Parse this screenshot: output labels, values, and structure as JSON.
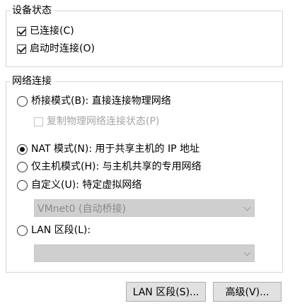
{
  "device_status": {
    "title": "设备状态",
    "connected": {
      "label": "已连接(C)",
      "checked": true
    },
    "connect_at_power_on": {
      "label": "启动时连接(O)",
      "checked": true
    }
  },
  "network_connection": {
    "title": "网络连接",
    "bridged": {
      "label": "桥接模式(B): 直接连接物理网络",
      "selected": false
    },
    "replicate_state": {
      "label": "复制物理网络连接状态(P)",
      "checked": false,
      "disabled": true
    },
    "nat": {
      "label": "NAT 模式(N): 用于共享主机的 IP 地址",
      "selected": true
    },
    "host_only": {
      "label": "仅主机模式(H): 与主机共享的专用网络",
      "selected": false
    },
    "custom": {
      "label": "自定义(U): 特定虚拟网络",
      "selected": false
    },
    "custom_select": {
      "value": "VMnet0 (自动桥接)",
      "disabled": true
    },
    "lan_segment": {
      "label": "LAN 区段(L):",
      "selected": false
    },
    "lan_select": {
      "value": "",
      "disabled": true
    }
  },
  "buttons": {
    "lan_segments": "LAN 区段(S)...",
    "advanced": "高级(V)..."
  }
}
